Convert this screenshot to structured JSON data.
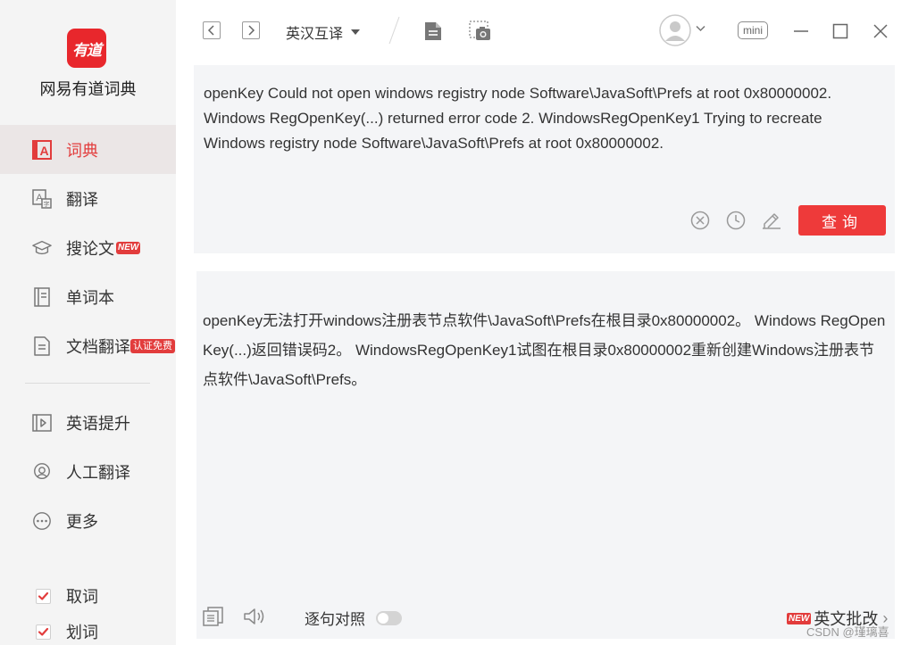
{
  "app": {
    "logo_text": "有道",
    "name": "网易有道词典"
  },
  "sidebar": {
    "items": [
      {
        "label": "词典",
        "icon": "dictionary-icon",
        "active": true
      },
      {
        "label": "翻译",
        "icon": "translate-icon"
      },
      {
        "label": "搜论文",
        "icon": "paper-cap-icon",
        "badge": "NEW"
      },
      {
        "label": "单词本",
        "icon": "wordbook-icon"
      },
      {
        "label": "文档翻译",
        "icon": "document-icon",
        "badge": "认证免费"
      },
      {
        "label": "英语提升",
        "icon": "video-play-icon"
      },
      {
        "label": "人工翻译",
        "icon": "human-translate-icon"
      },
      {
        "label": "更多",
        "icon": "more-icon"
      }
    ],
    "checkboxes": [
      {
        "label": "取词",
        "checked": true
      },
      {
        "label": "划词",
        "checked": true
      }
    ]
  },
  "toolbar": {
    "language": "英汉互译",
    "mini_label": "mini"
  },
  "input": {
    "text": "openKey Could not open windows registry node Software\\JavaSoft\\Prefs at root 0x80000002. Windows RegOpenKey(...) returned error code 2.   WindowsRegOpenKey1 Trying to recreate Windows registry node Software\\JavaSoft\\Prefs at root 0x80000002.",
    "query_label": "查询"
  },
  "output": {
    "text": "openKey无法打开windows注册表节点软件\\JavaSoft\\Prefs在根目录0x80000002。 Windows RegOpenKey(...)返回错误码2。 WindowsRegOpenKey1试图在根目录0x80000002重新创建Windows注册表节点软件\\JavaSoft\\Prefs。",
    "sentence_align_label": "逐句对照",
    "essay_label": "英文批改",
    "essay_badge": "NEW",
    "essay_arrow": "›"
  },
  "watermark": "CSDN @瑾璃喜",
  "colors": {
    "accent": "#e23c3c",
    "sidebar_bg": "#f4f4f4",
    "panel_bg": "#f4f5f7"
  }
}
